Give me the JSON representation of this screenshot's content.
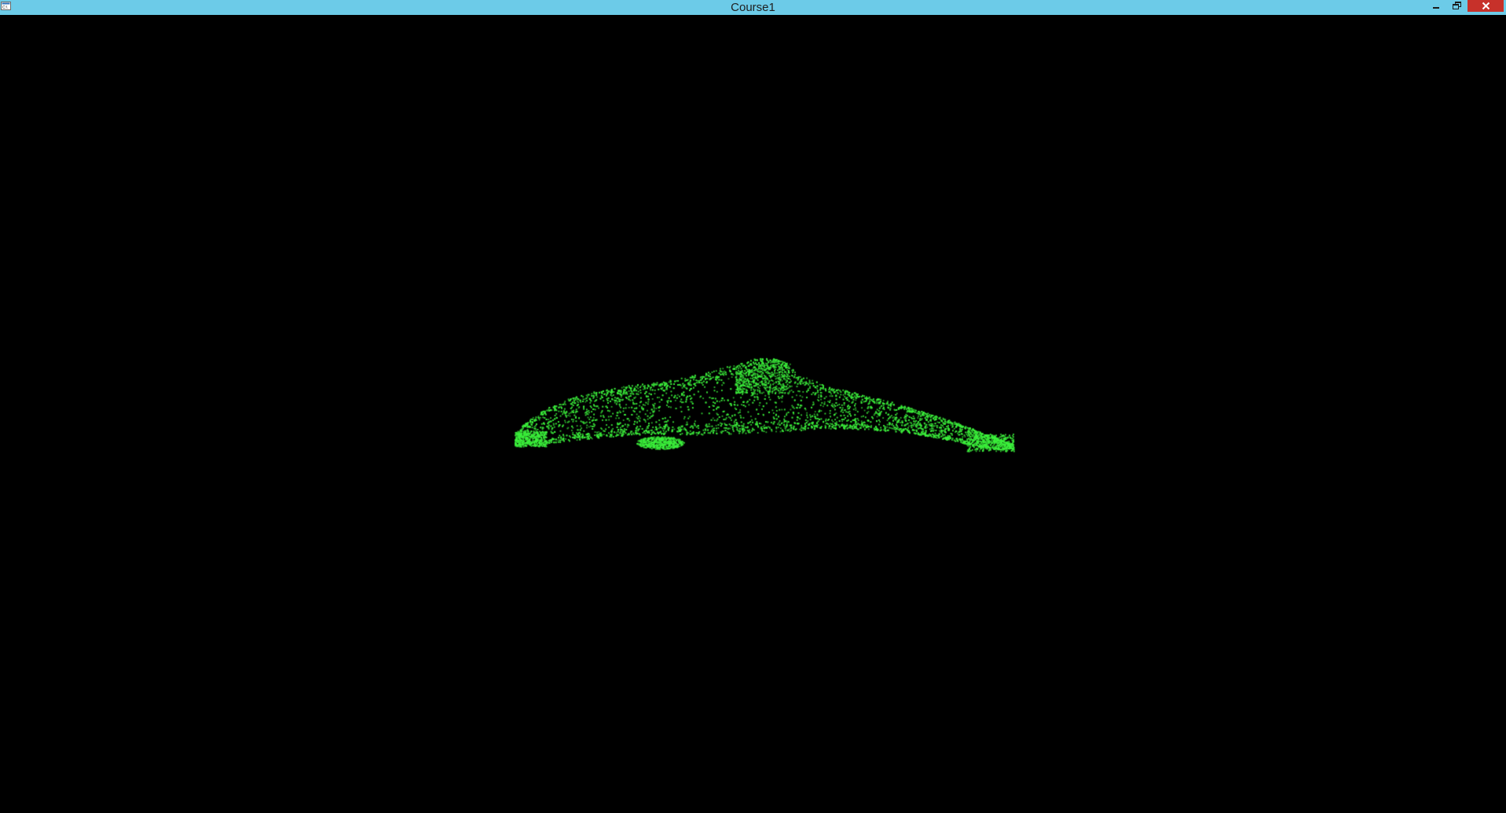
{
  "window": {
    "title": "Course1",
    "titlebar_color": "#6ccbe8",
    "close_button_color": "#c7312a",
    "background_color": "#000000"
  },
  "controls": {
    "minimize_icon": "minimize-icon",
    "restore_icon": "restore-icon",
    "close_icon": "close-icon"
  },
  "scene": {
    "object": "dolphin",
    "render_mode": "point-cloud",
    "point_color": "#3cf03c"
  }
}
